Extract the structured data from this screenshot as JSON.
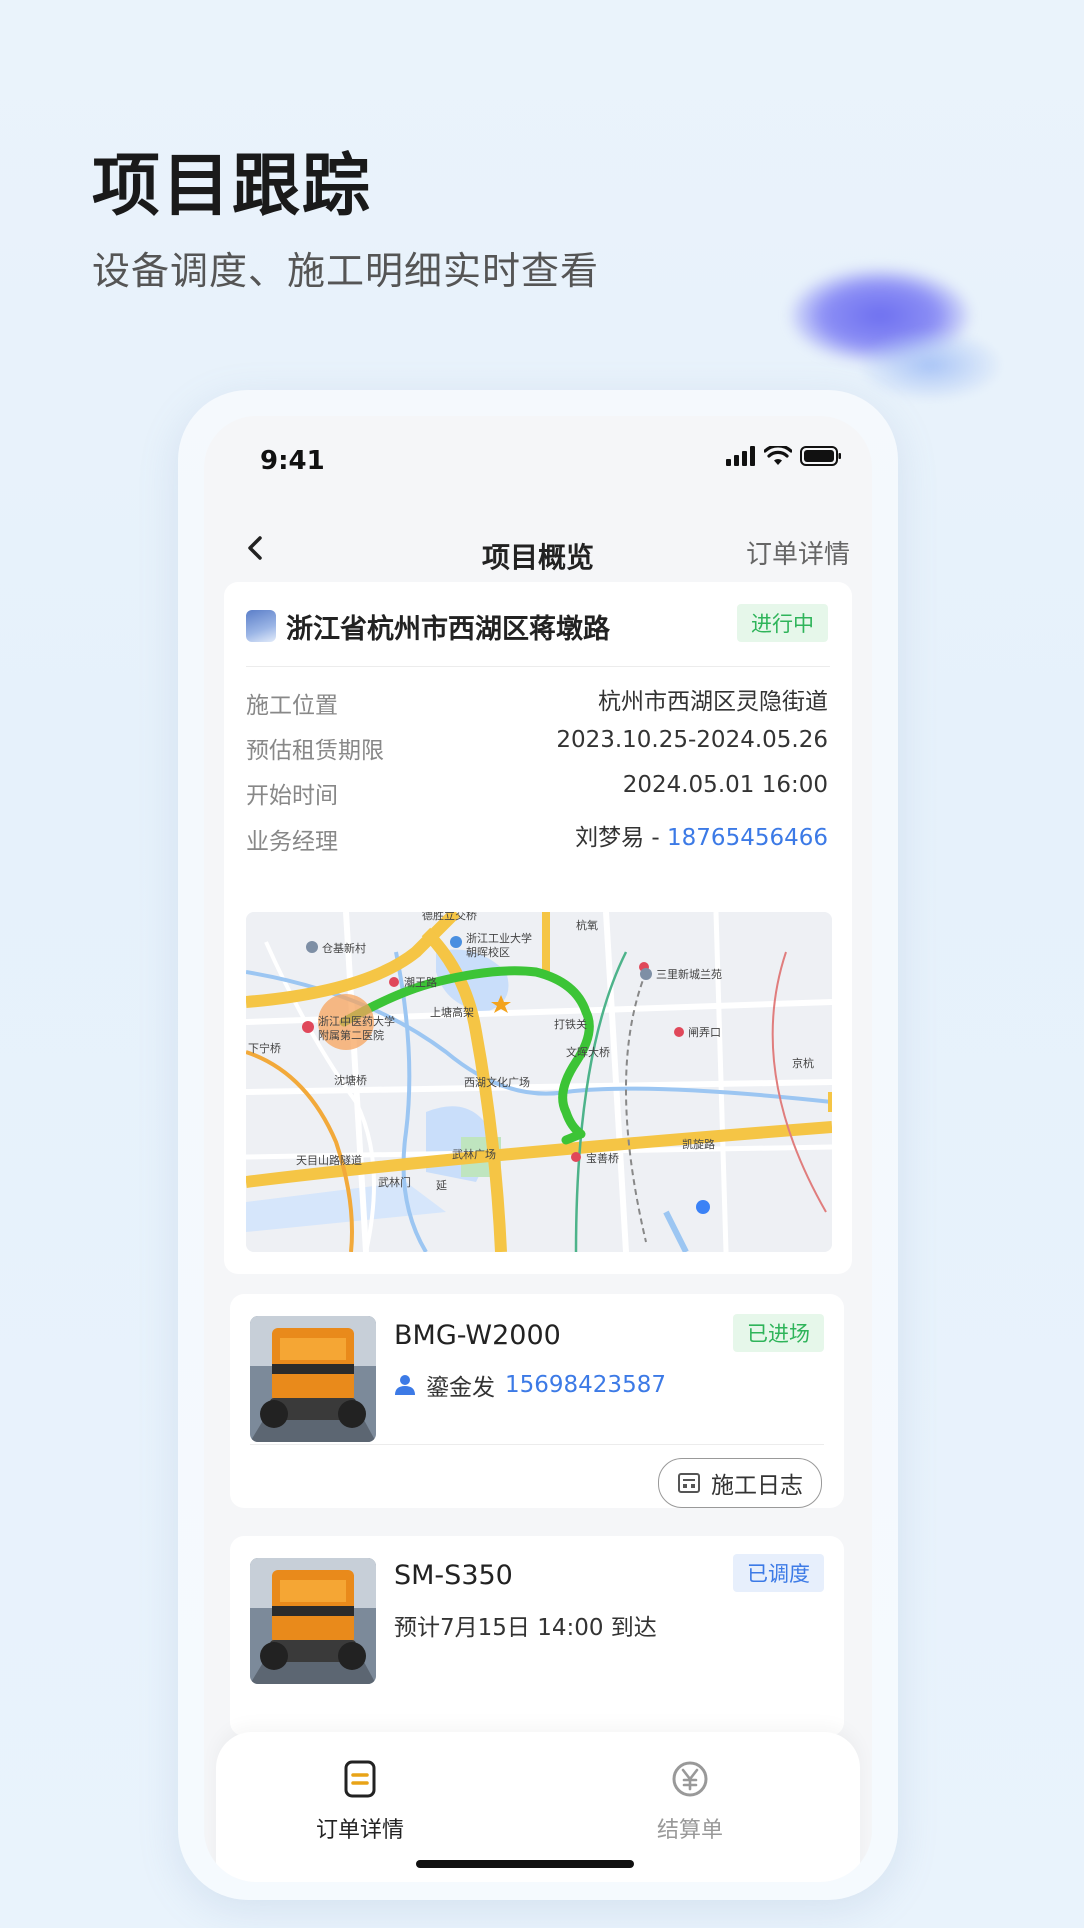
{
  "hero": {
    "title": "项目跟踪",
    "subtitle": "设备调度、施工明细实时查看"
  },
  "status_bar": {
    "time": "9:41"
  },
  "nav": {
    "back_icon": "chevron-left-icon",
    "title": "项目概览",
    "right_label": "订单详情"
  },
  "project": {
    "icon": "project-icon",
    "title": "浙江省杭州市西湖区蒋墩路",
    "status": "进行中",
    "status_color": "#2fb45a",
    "rows": [
      {
        "label": "施工位置",
        "value": "杭州市西湖区灵隐街道"
      },
      {
        "label": "预估租赁期限",
        "value": "2023.10.25-2024.05.26"
      },
      {
        "label": "开始时间",
        "value": "2024.05.01 16:00"
      },
      {
        "label": "业务经理",
        "value": "刘梦易 - ",
        "phone": "18765456466"
      }
    ],
    "map": {
      "route_color": "#3cc436",
      "labels": [
        "德胜立交桥",
        "仓基新村",
        "浙江工业大学",
        "朝晖校区",
        "杭氧",
        "三里新城兰苑",
        "潮王路",
        "上塘高架",
        "浙江中医药大学",
        "附属第二医院",
        "打铁关",
        "闸弄口",
        "文晖大桥",
        "下宁桥",
        "沈塘桥",
        "西湖文化广场",
        "京杭",
        "天目山路隧道",
        "武林广场",
        "宝善桥",
        "凯旋路",
        "武林门",
        "延"
      ]
    }
  },
  "equipment": [
    {
      "name": "BMG-W2000",
      "status": "已进场",
      "status_color": "#2fb45a",
      "person_icon": "person-icon",
      "operator": "鎏金发",
      "phone": "15698423587",
      "log_button": "施工日志",
      "log_icon": "log-icon"
    },
    {
      "name": "SM-S350",
      "status": "已调度",
      "status_color": "#3c7ae6",
      "eta": "预计7月15日 14:00 到达"
    }
  ],
  "tabbar": {
    "tabs": [
      {
        "label": "订单详情",
        "icon": "document-icon",
        "active": true
      },
      {
        "label": "结算单",
        "icon": "yen-icon",
        "active": false
      }
    ],
    "active_color": "#e8a317"
  }
}
